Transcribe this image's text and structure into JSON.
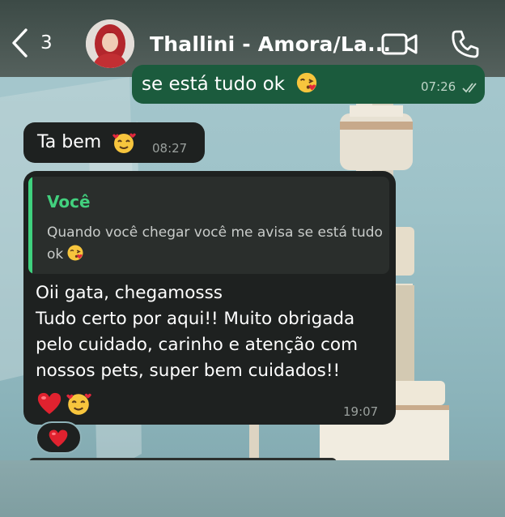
{
  "header": {
    "back_count": "3",
    "contact_name": "Thallini - Amora/La...",
    "video_icon": "video-camera-icon",
    "call_icon": "phone-icon"
  },
  "messages": {
    "sent": {
      "text": "se está tudo ok",
      "emoji": "kissing-face-emoji",
      "time": "07:26",
      "status": "read"
    },
    "received_short": {
      "text": "Ta bem",
      "emoji": "smiling-face-with-hearts-emoji",
      "time": "08:27"
    },
    "received_reply": {
      "quote": {
        "author": "Você",
        "text": "Quando você chegar você me avisa se está tudo ok"
      },
      "text": "Oii gata, chegamosss\nTudo certo por aqui!! Muito obrigada pelo cuidado, carinho e atenção com nossos pets, super bem cuidados!!",
      "emojis": [
        "red-heart-emoji",
        "smiling-face-with-hearts-emoji"
      ],
      "time": "19:07",
      "reaction": "red-heart-emoji"
    }
  },
  "colors": {
    "header": "#3c4a46",
    "sent_bubble": "#1b5b3d",
    "received_bubble": "#1e2120",
    "quote_accent": "#3fd17e",
    "quote_author": "#42d07e"
  }
}
